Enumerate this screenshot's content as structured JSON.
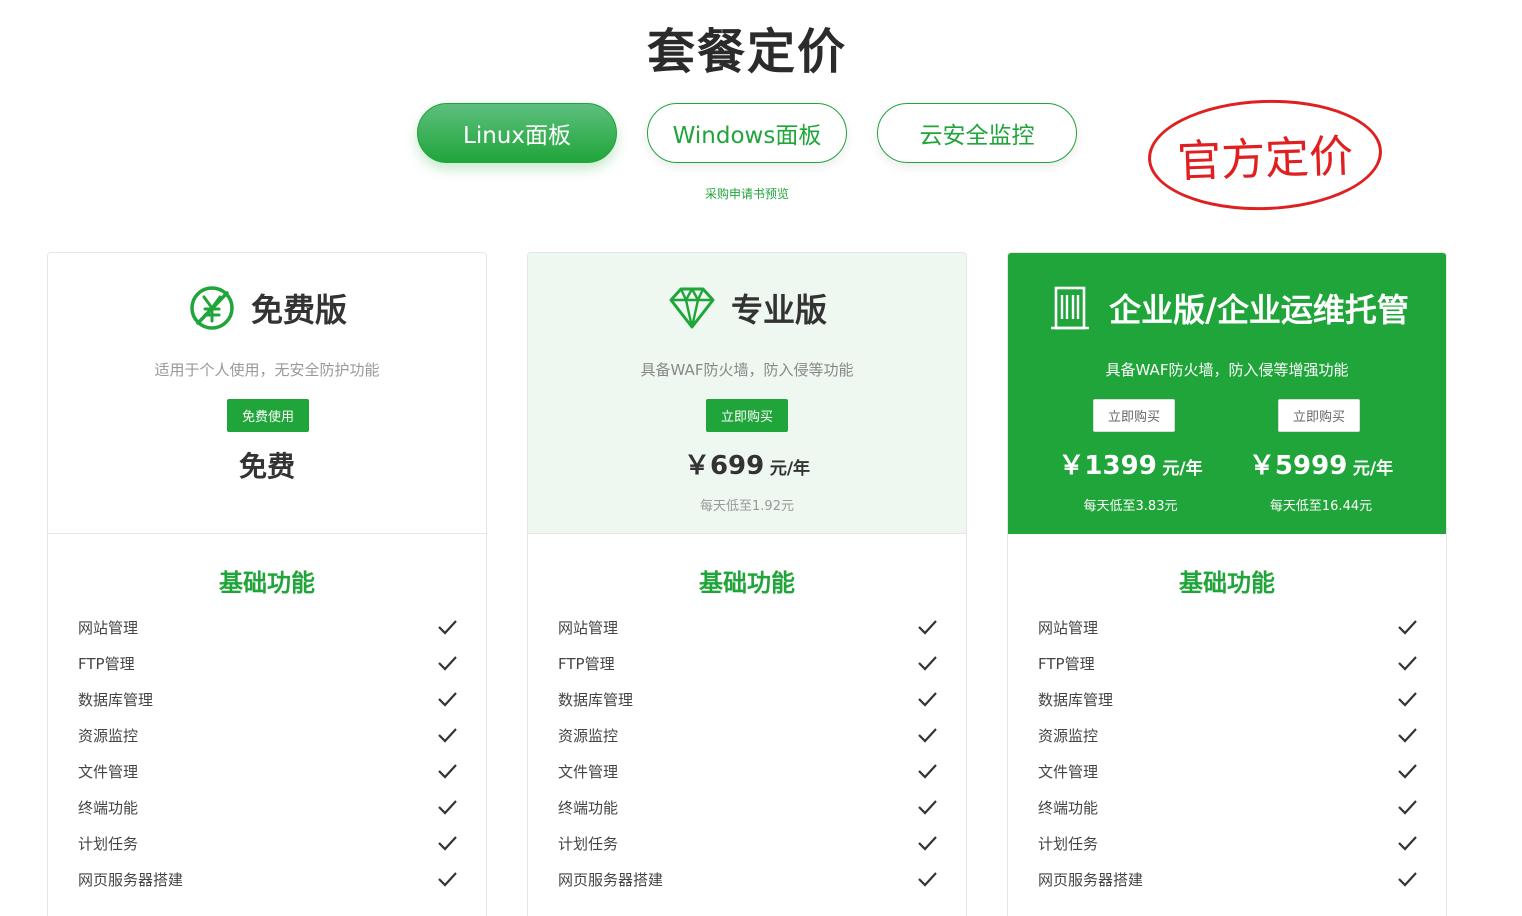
{
  "page": {
    "title": "套餐定价"
  },
  "tabs": [
    {
      "label": "Linux面板",
      "active": true
    },
    {
      "label": "Windows面板",
      "active": false
    },
    {
      "label": "云安全监控",
      "active": false
    }
  ],
  "preview_link": "采购申请书预览",
  "stamp": "官方定价",
  "colors": {
    "brand": "#20a53a",
    "stamp": "#e02020"
  },
  "plans": {
    "free": {
      "icon": "no-yen-icon",
      "title": "免费版",
      "desc": "适用于个人使用，无安全防护功能",
      "button": "免费使用",
      "price": "免费"
    },
    "pro": {
      "icon": "diamond-icon",
      "title": "专业版",
      "desc": "具备WAF防火墙，防入侵等功能",
      "button": "立即购买",
      "currency": "￥",
      "amount": "699",
      "unit": "元/年",
      "daily": "每天低至1.92元"
    },
    "enterprise": {
      "icon": "building-icon",
      "title": "企业版/企业运维托管",
      "desc": "具备WAF防火墙，防入侵等增强功能",
      "options": [
        {
          "button": "立即购买",
          "currency": "￥",
          "amount": "1399",
          "unit": "元/年",
          "daily": "每天低至3.83元"
        },
        {
          "button": "立即购买",
          "currency": "￥",
          "amount": "5999",
          "unit": "元/年",
          "daily": "每天低至16.44元"
        }
      ]
    }
  },
  "features": {
    "section_title": "基础功能",
    "items": [
      "网站管理",
      "FTP管理",
      "数据库管理",
      "资源监控",
      "文件管理",
      "终端功能",
      "计划任务",
      "网页服务器搭建"
    ]
  }
}
